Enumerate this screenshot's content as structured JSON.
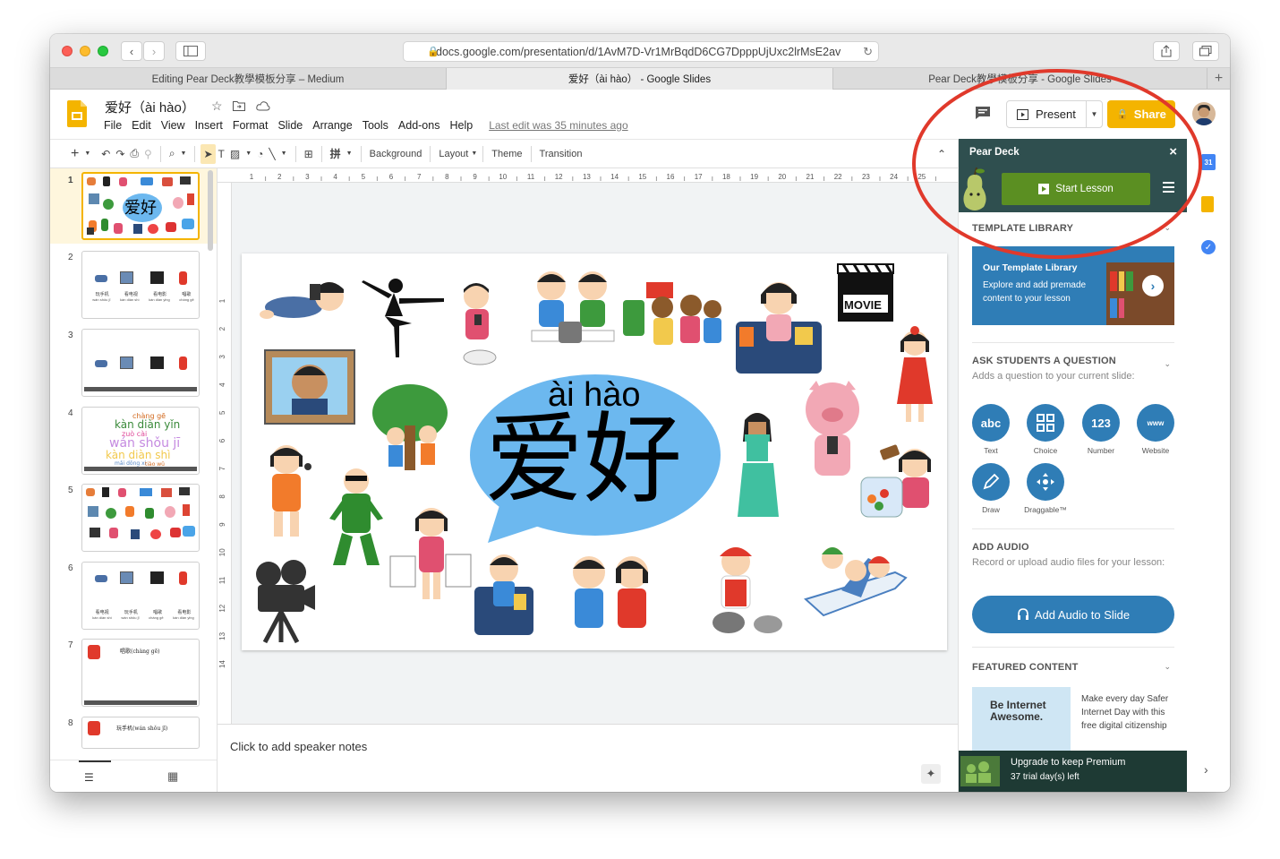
{
  "browser": {
    "url": "docs.google.com/presentation/d/1AvM7D-Vr1MrBqdD6CG7DpppUjUxc2lrMsE2av",
    "tabs": [
      {
        "label": "Editing Pear Deck教學模板分享 – Medium"
      },
      {
        "label": "爱好（ài hào） - Google Slides"
      },
      {
        "label": "Pear Deck教學模板分享 - Google Slides"
      }
    ]
  },
  "doc": {
    "title": "爱好（ài hào）",
    "menu": [
      "File",
      "Edit",
      "View",
      "Insert",
      "Format",
      "Slide",
      "Arrange",
      "Tools",
      "Add-ons",
      "Help"
    ],
    "last_edit": "Last edit was 35 minutes ago",
    "present_label": "Present",
    "share_label": "Share"
  },
  "toolbar": {
    "background": "Background",
    "layout": "Layout",
    "theme": "Theme",
    "transition": "Transition"
  },
  "ruler": {
    "ticks": [
      "1",
      "2",
      "3",
      "4",
      "5",
      "6",
      "7",
      "8",
      "9",
      "10",
      "11",
      "12",
      "13",
      "14",
      "15",
      "16",
      "17",
      "18",
      "19",
      "20",
      "21",
      "22",
      "23",
      "24",
      "25"
    ],
    "vticks": [
      "1",
      "2",
      "3",
      "4",
      "5",
      "6",
      "7",
      "8",
      "9",
      "10",
      "11",
      "12",
      "13",
      "14"
    ]
  },
  "slide": {
    "pinyin": "ài hào",
    "hanzi": "爱好",
    "movie_sign": "MOVIE"
  },
  "filmstrip": {
    "numbers": [
      "1",
      "2",
      "3",
      "4",
      "5",
      "6",
      "7",
      "8"
    ],
    "s2_labels": [
      "玩手机",
      "看电视",
      "看电影",
      "唱歌"
    ],
    "s2_pinyin": [
      "wán shǒu jī",
      "kàn diàn shì",
      "kàn diàn yǐng",
      "chàng gē"
    ],
    "s4_words": [
      "chàng gē",
      "kàn diàn yǐn",
      "zuò cài",
      "wán shǒu jī",
      "kàn diàn shì",
      "mǎi dōng xi",
      "tiào wǔ"
    ],
    "s6_labels": [
      "看电视",
      "玩手机",
      "唱歌",
      "看电影"
    ],
    "s6_pinyin": [
      "kàn diàn shì",
      "wán shǒu jī",
      "chàng gē",
      "kàn diàn yǐng"
    ],
    "s7_title": "唱歌(chàng gē)",
    "s8_title": "玩手机(wán shǒu jī)"
  },
  "notes": {
    "placeholder": "Click to add speaker notes"
  },
  "peardeck": {
    "title": "Pear Deck",
    "start_lesson": "Start Lesson",
    "template_library": {
      "head": "TEMPLATE LIBRARY",
      "card_title": "Our Template Library",
      "card_body": "Explore and add premade content to your lesson"
    },
    "ask": {
      "head": "ASK STUDENTS A QUESTION",
      "sub": "Adds a question to your current slide:",
      "buttons": [
        {
          "icon": "abc",
          "label": "Text"
        },
        {
          "icon": "",
          "label": "Choice"
        },
        {
          "icon": "123",
          "label": "Number"
        },
        {
          "icon": "www",
          "label": "Website"
        },
        {
          "icon": "",
          "label": "Draw"
        },
        {
          "icon": "",
          "label": "Draggable™"
        }
      ]
    },
    "audio": {
      "head": "ADD AUDIO",
      "sub": "Record or upload audio files for your lesson:",
      "button": "Add Audio to Slide"
    },
    "featured": {
      "head": "FEATURED CONTENT",
      "thumb_text": "Be Internet Awesome.",
      "body": "Make every day Safer Internet Day with this free digital citizenship"
    },
    "upgrade": {
      "line1": "Upgrade to keep Premium",
      "line2": "37 trial day(s) left"
    }
  },
  "colors": {
    "pear_green": "#5b8f22",
    "pear_dark": "#2f4f4f",
    "accent_blue": "#2f7db6",
    "share_yellow": "#f4b400",
    "highlight_red": "#e0392b",
    "speech_blue": "#6cb8ef"
  }
}
